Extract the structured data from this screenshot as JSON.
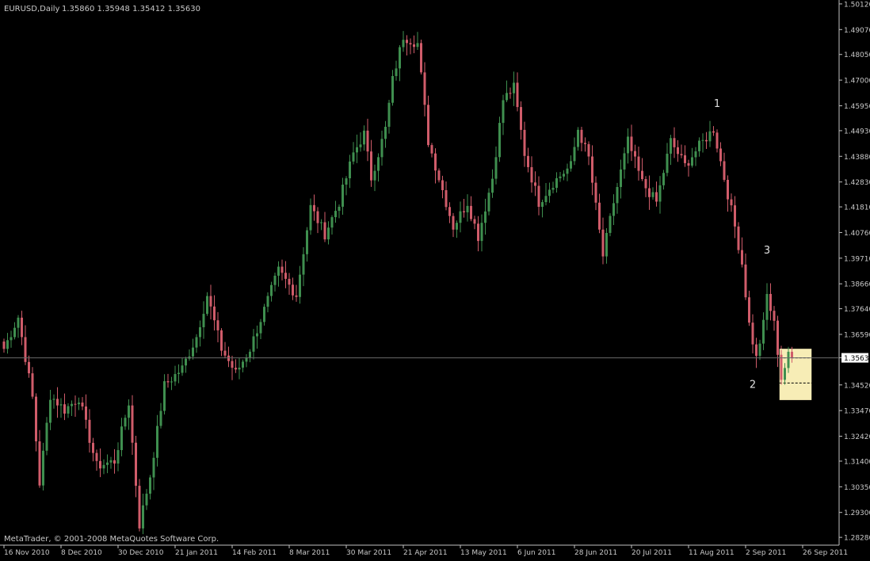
{
  "header": {
    "symbol": "EURUSD,Daily",
    "ohlc": "1.35860 1.35948 1.35412 1.35630"
  },
  "footer": {
    "copyright": "MetaTrader, © 2001-2008 MetaQuotes Software Corp."
  },
  "colors": {
    "background": "#000000",
    "bull": "#3f8f4f",
    "bear": "#d05c6a",
    "axis": "#c0c0c0",
    "text": "#c8c8c8",
    "highlight": "#f7edb6",
    "current_price_bg": "#ffffff"
  },
  "chart_data": {
    "type": "candlestick",
    "ylim": [
      1.2796,
      1.5028
    ],
    "y_ticks": [
      "1.50120",
      "1.49070",
      "1.48050",
      "1.47000",
      "1.45950",
      "1.44930",
      "1.43880",
      "1.42830",
      "1.41810",
      "1.40760",
      "1.39710",
      "1.38660",
      "1.37640",
      "1.36590",
      "1.35630",
      "1.34520",
      "1.33470",
      "1.32420",
      "1.31400",
      "1.30350",
      "1.29300",
      "1.28280"
    ],
    "current_price": 1.3563,
    "current_price_label": "1.35630",
    "x_ticks": [
      "16 Nov 2010",
      "8 Dec 2010",
      "30 Dec 2010",
      "21 Jan 2011",
      "14 Feb 2011",
      "8 Mar 2011",
      "30 Mar 2011",
      "21 Apr 2011",
      "13 May 2011",
      "6 Jun 2011",
      "28 Jun 2011",
      "20 Jul 2011",
      "11 Aug 2011",
      "2 Sep 2011",
      "26 Sep 2011"
    ],
    "x_tick_bar_index": [
      0,
      16,
      32,
      48,
      64,
      80,
      96,
      112,
      128,
      144,
      160,
      176,
      192,
      208,
      224
    ],
    "anchors": [
      [
        0,
        1.36
      ],
      [
        4,
        1.373
      ],
      [
        8,
        1.34
      ],
      [
        10,
        1.305
      ],
      [
        13,
        1.341
      ],
      [
        17,
        1.335
      ],
      [
        21,
        1.34
      ],
      [
        26,
        1.312
      ],
      [
        31,
        1.314
      ],
      [
        35,
        1.338
      ],
      [
        38,
        1.288
      ],
      [
        41,
        1.308
      ],
      [
        45,
        1.345
      ],
      [
        50,
        1.352
      ],
      [
        54,
        1.365
      ],
      [
        57,
        1.382
      ],
      [
        61,
        1.36
      ],
      [
        65,
        1.35
      ],
      [
        69,
        1.36
      ],
      [
        73,
        1.376
      ],
      [
        77,
        1.392
      ],
      [
        82,
        1.382
      ],
      [
        86,
        1.418
      ],
      [
        90,
        1.407
      ],
      [
        94,
        1.42
      ],
      [
        98,
        1.44
      ],
      [
        101,
        1.448
      ],
      [
        103,
        1.43
      ],
      [
        107,
        1.45
      ],
      [
        109,
        1.47
      ],
      [
        112,
        1.488
      ],
      [
        116,
        1.485
      ],
      [
        119,
        1.445
      ],
      [
        122,
        1.43
      ],
      [
        126,
        1.41
      ],
      [
        130,
        1.42
      ],
      [
        133,
        1.406
      ],
      [
        137,
        1.43
      ],
      [
        140,
        1.462
      ],
      [
        143,
        1.467
      ],
      [
        146,
        1.44
      ],
      [
        150,
        1.42
      ],
      [
        154,
        1.428
      ],
      [
        159,
        1.435
      ],
      [
        161,
        1.45
      ],
      [
        164,
        1.438
      ],
      [
        168,
        1.398
      ],
      [
        171,
        1.42
      ],
      [
        175,
        1.445
      ],
      [
        179,
        1.428
      ],
      [
        183,
        1.42
      ],
      [
        187,
        1.445
      ],
      [
        191,
        1.435
      ],
      [
        195,
        1.443
      ],
      [
        199,
        1.45
      ],
      [
        202,
        1.43
      ],
      [
        205,
        1.41
      ],
      [
        207,
        1.395
      ],
      [
        209,
        1.37
      ],
      [
        211,
        1.356
      ],
      [
        213,
        1.37
      ],
      [
        214,
        1.382
      ],
      [
        216,
        1.37
      ],
      [
        218,
        1.348
      ],
      [
        220,
        1.357
      ],
      [
        221,
        1.3563
      ]
    ],
    "annotations": [
      {
        "label": "1",
        "bar": 200,
        "price": 1.459
      },
      {
        "label": "3",
        "bar": 214,
        "price": 1.399
      },
      {
        "label": "2",
        "bar": 210,
        "price": 1.344
      }
    ],
    "highlight_box": {
      "bar_start": 217.5,
      "bar_end": 226.5,
      "price_top": 1.36,
      "price_bottom": 1.339,
      "lines": [
        1.3563,
        1.346
      ]
    }
  }
}
